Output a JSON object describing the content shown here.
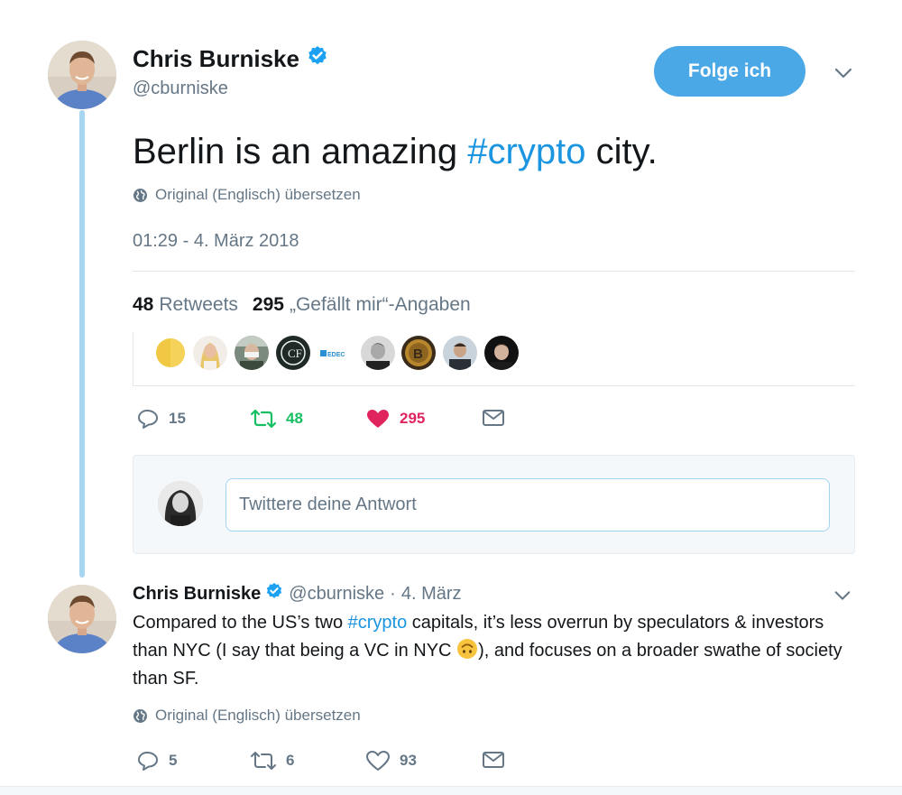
{
  "main_tweet": {
    "author_name": "Chris Burniske",
    "handle": "@cburniske",
    "follow_label": "Folge ich",
    "text_before": "Berlin is an amazing ",
    "hashtag": "#crypto",
    "text_after": " city.",
    "translate_label": "Original (Englisch) übersetzen",
    "timestamp": "01:29 - 4. März 2018",
    "retweets_count": "48",
    "retweets_label": "Retweets",
    "likes_count": "295",
    "likes_label": "„Gefällt mir“-Angaben",
    "likers_logo_text": "EDEC",
    "actions": {
      "reply_count": "15",
      "retweet_count": "48",
      "like_count": "295"
    }
  },
  "reply_composer": {
    "placeholder": "Twittere deine Antwort"
  },
  "reply_tweet": {
    "author_name": "Chris Burniske",
    "handle": "@cburniske",
    "dot": "·",
    "date": "4. März",
    "text_part1": "Compared to the US’s two ",
    "hashtag": "#crypto",
    "text_part2": " capitals, it’s less overrun by speculators & investors than NYC (I say that being a VC in NYC ",
    "text_part3": "), and focuses on a broader swathe of society than SF.",
    "translate_label": "Original (Englisch) übersetzen",
    "actions": {
      "reply_count": "5",
      "retweet_count": "6",
      "like_count": "93"
    }
  },
  "colors": {
    "accent": "#1b95e0",
    "follow_button": "#4ba8e6",
    "retweet_green": "#17bf63",
    "like_red": "#e0245e",
    "thread_line": "#a8d5ef"
  },
  "icons": [
    "verified-badge-icon",
    "globe-icon",
    "chevron-down-icon",
    "reply-icon",
    "retweet-icon",
    "heart-icon",
    "mail-icon",
    "upside-down-face-emoji"
  ]
}
